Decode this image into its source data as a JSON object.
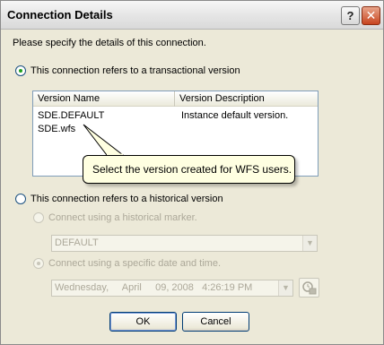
{
  "window": {
    "title": "Connection Details",
    "help_glyph": "?",
    "close_glyph": "✕"
  },
  "intro": "Please specify the details of this connection.",
  "transactional": {
    "label": "This connection refers to a transactional version",
    "selected": true,
    "columns": [
      "Version Name",
      "Version Description"
    ],
    "rows": [
      {
        "name": "SDE.DEFAULT",
        "description": "Instance default version."
      },
      {
        "name": "SDE.wfs",
        "description": ""
      }
    ]
  },
  "tooltip": "Select the version created for WFS users.",
  "historical": {
    "label": "This connection refers to a historical version",
    "selected": false,
    "marker_option": "Connect using a historical marker.",
    "marker_value": "DEFAULT",
    "date_option": "Connect using a specific date and time.",
    "date_value": "Wednesday,     April     09, 2008   4:26:19 PM"
  },
  "buttons": {
    "ok": "OK",
    "cancel": "Cancel"
  },
  "icons": {
    "dropdown": "chevron-down-icon",
    "calendar": "calendar-icon"
  },
  "colors": {
    "dialog_bg": "#ece9d8",
    "tooltip_bg": "#ffffe1",
    "list_border": "#7f9db9",
    "disabled_text": "#aca899"
  }
}
